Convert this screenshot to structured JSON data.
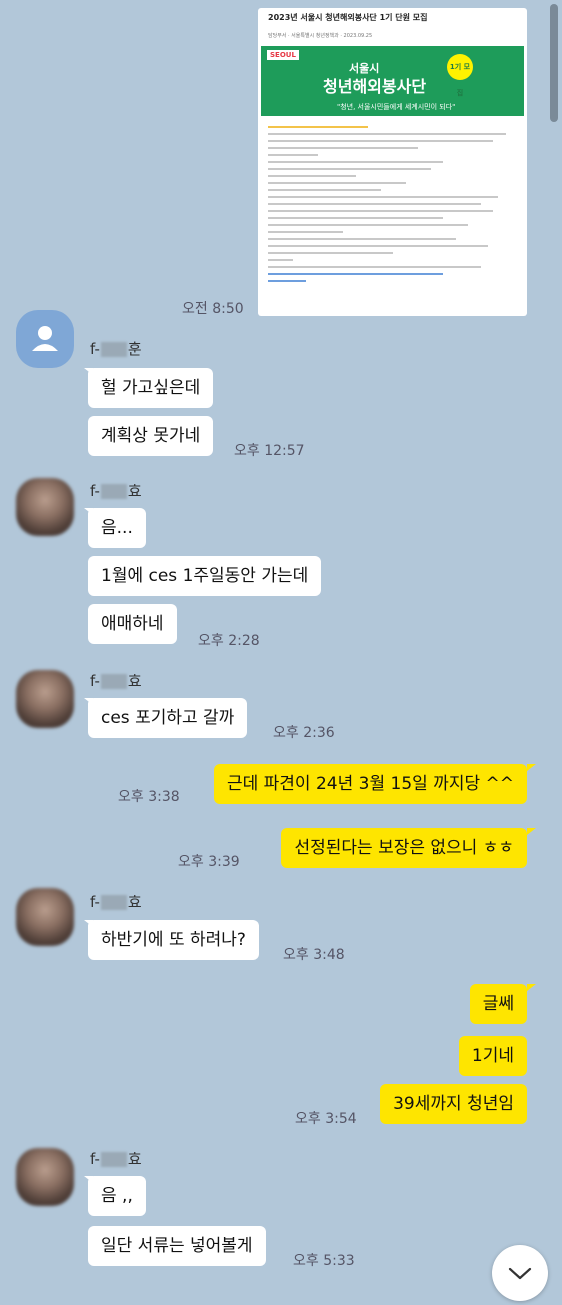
{
  "image_card": {
    "title": "2023년 서울시 청년해외봉사단 1기 단원 모집",
    "banner_line1": "서울시",
    "banner_line2": "청년해외봉사단",
    "banner_line3": "\"청년, 서울시민들에게 세계시민이 되다\"",
    "badge": "1기 모집",
    "logo": "SEOUL",
    "meta": "담당부서 · 서울특별시 청년정책과 · 2023.09.25",
    "time": "오전 8:50"
  },
  "messages": [
    {
      "sender": "f-김훈",
      "name_prefix": "f-",
      "name_suffix": "훈",
      "lines": [
        "헐 가고싶은데",
        "계획상 못가네"
      ],
      "time": "오후 12:57"
    },
    {
      "sender": "f-효",
      "name_prefix": "f-",
      "name_suffix": "효",
      "lines": [
        "음...",
        "1월에 ces 1주일동안 가는데",
        "애매하네"
      ],
      "time": "오후 2:28"
    },
    {
      "sender": "f-효",
      "name_prefix": "f-",
      "name_suffix": "효",
      "lines": [
        "ces 포기하고 갈까"
      ],
      "time": "오후 2:36"
    },
    {
      "sender": "me",
      "lines": [
        "근데 파견이 24년 3월 15일 까지당 ^^"
      ],
      "time": "오후 3:38"
    },
    {
      "sender": "me",
      "lines": [
        "선정된다는 보장은 없으니 ㅎㅎ"
      ],
      "time": "오후 3:39"
    },
    {
      "sender": "f-효",
      "name_prefix": "f-",
      "name_suffix": "효",
      "lines": [
        "하반기에 또 하려나?"
      ],
      "time": "오후 3:48"
    },
    {
      "sender": "me",
      "lines": [
        "글쎄",
        "1기네",
        "39세까지 청년임"
      ],
      "time": "오후 3:54"
    },
    {
      "sender": "f-효",
      "name_prefix": "f-",
      "name_suffix": "효",
      "lines": [
        "음 ,,",
        "일단 서류는 넣어볼게"
      ],
      "time": "오후 5:33"
    }
  ],
  "icons": {
    "default_avatar": "person-icon",
    "scroll_down": "chevron-down-icon"
  },
  "colors": {
    "background": "#b2c7d9",
    "my_bubble": "#fee500",
    "their_bubble": "#ffffff"
  }
}
